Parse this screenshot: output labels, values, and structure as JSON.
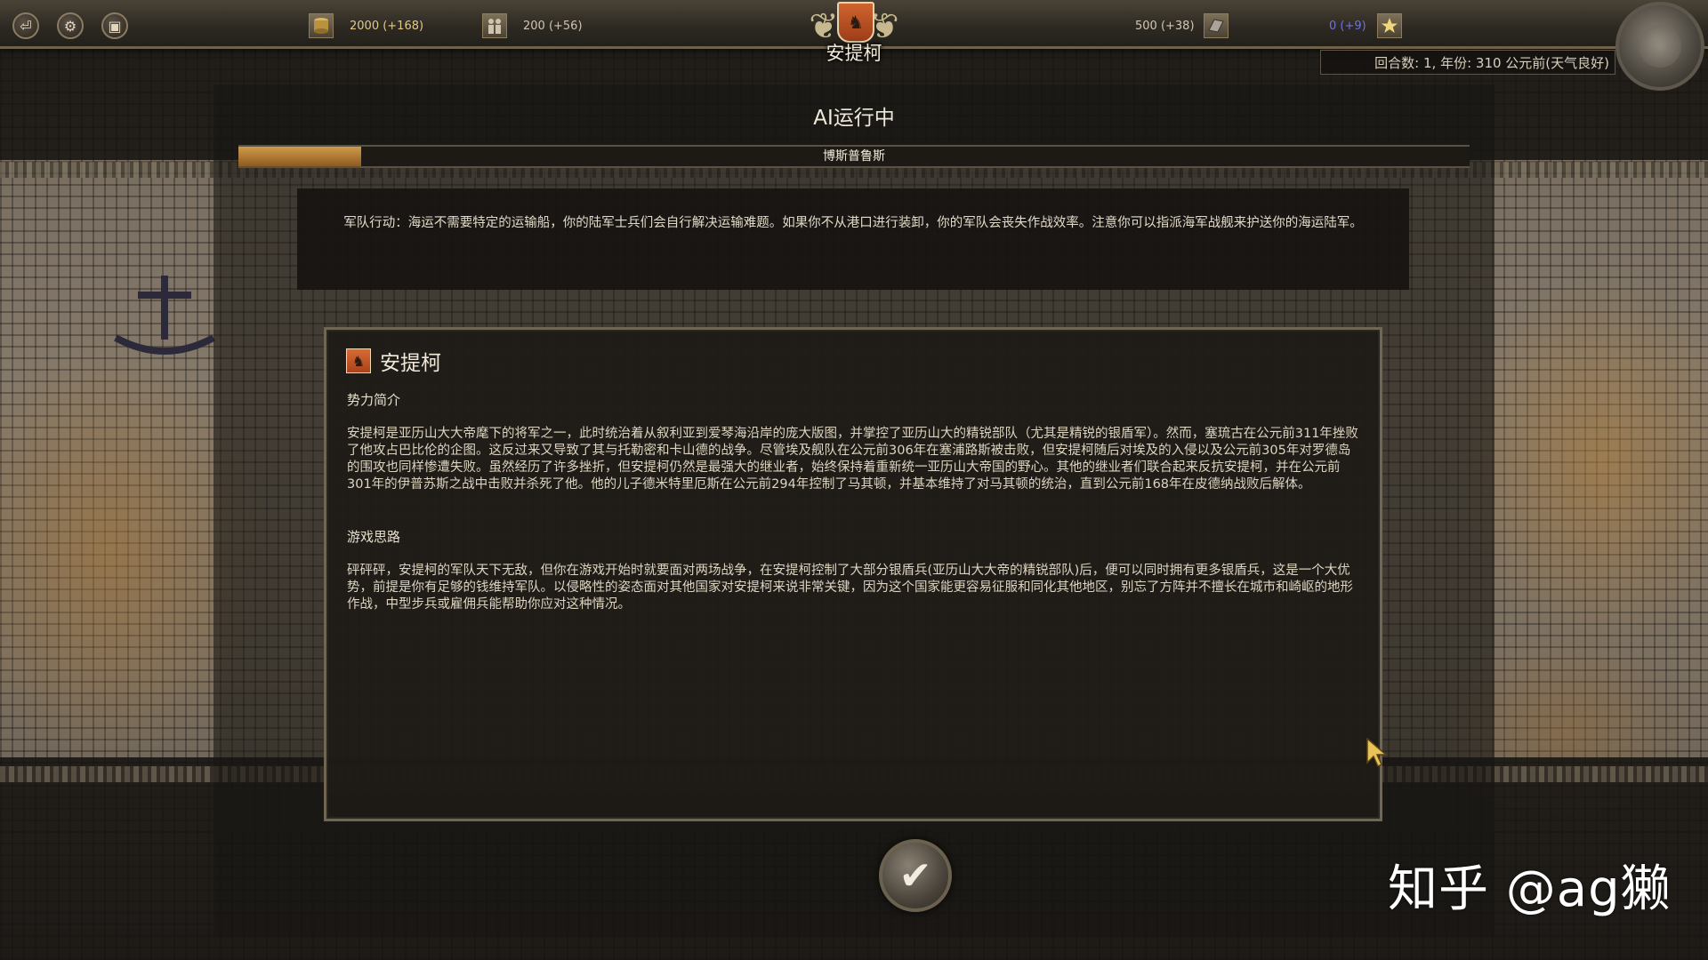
{
  "topbar": {
    "buttons": [
      {
        "icon": "exit-icon"
      },
      {
        "icon": "gear-icon"
      },
      {
        "icon": "save-icon"
      }
    ],
    "gold": {
      "value": "2000 (+168)",
      "icon": "coins-icon"
    },
    "population": {
      "value": "200 (+56)",
      "icon": "people-icon"
    },
    "resource_right": {
      "value": "500 (+38)",
      "icon": "scroll-icon"
    },
    "prestige": {
      "value": "0 (+9)",
      "icon": "star-icon",
      "color": "#6c74d8"
    },
    "faction_emblem": {
      "name": "安提柯",
      "icon": "pegasus-icon",
      "color": "#c45624"
    },
    "turn_info": "回合数: 1, 年份: 310 公元前(天气良好)"
  },
  "panel": {
    "title": "AI运行中",
    "progress": {
      "label": "博斯普鲁斯",
      "fraction": 0.1,
      "color": "#c08a3e"
    },
    "tip": "军队行动：海运不需要特定的运输船，你的陆军士兵们会自行解决运输难题。如果你不从港口进行装卸，你的军队会丧失作战效率。注意你可以指派海军战舰来护送你的海运陆军。",
    "faction": {
      "name": "安提柯",
      "icon": "pegasus-icon",
      "intro_title": "势力简介",
      "intro_body": "安提柯是亚历山大大帝麾下的将军之一，此时统治着从叙利亚到爱琴海沿岸的庞大版图，并掌控了亚历山大的精锐部队（尤其是精锐的银盾军）。然而，塞琉古在公元前311年挫败了他攻占巴比伦的企图。这反过来又导致了其与托勒密和卡山德的战争。尽管埃及舰队在公元前306年在塞浦路斯被击败，但安提柯随后对埃及的入侵以及公元前305年对罗德岛的围攻也同样惨遭失败。虽然经历了许多挫折，但安提柯仍然是最强大的继业者，始终保持着重新统一亚历山大帝国的野心。其他的继业者们联合起来反抗安提柯，并在公元前301年的伊普苏斯之战中击败并杀死了他。他的儿子德米特里厄斯在公元前294年控制了马其顿，并基本维持了对马其顿的统治，直到公元前168年在皮德纳战败后解体。",
      "strategy_title": "游戏思路",
      "strategy_body": "砰砰砰，安提柯的军队天下无敌，但你在游戏开始时就要面对两场战争，在安提柯控制了大部分银盾兵(亚历山大大帝的精锐部队)后，便可以同时拥有更多银盾兵，这是一个大优势，前提是你有足够的钱维持军队。以侵略性的姿态面对其他国家对安提柯来说非常关键，因为这个国家能更容易征服和同化其他地区，别忘了方阵并不擅长在城市和崎岖的地形作战，中型步兵或雇佣兵能帮助你应对这种情况。"
    },
    "confirm_icon": "checkmark-icon"
  },
  "watermark": "知乎 @ag獭"
}
